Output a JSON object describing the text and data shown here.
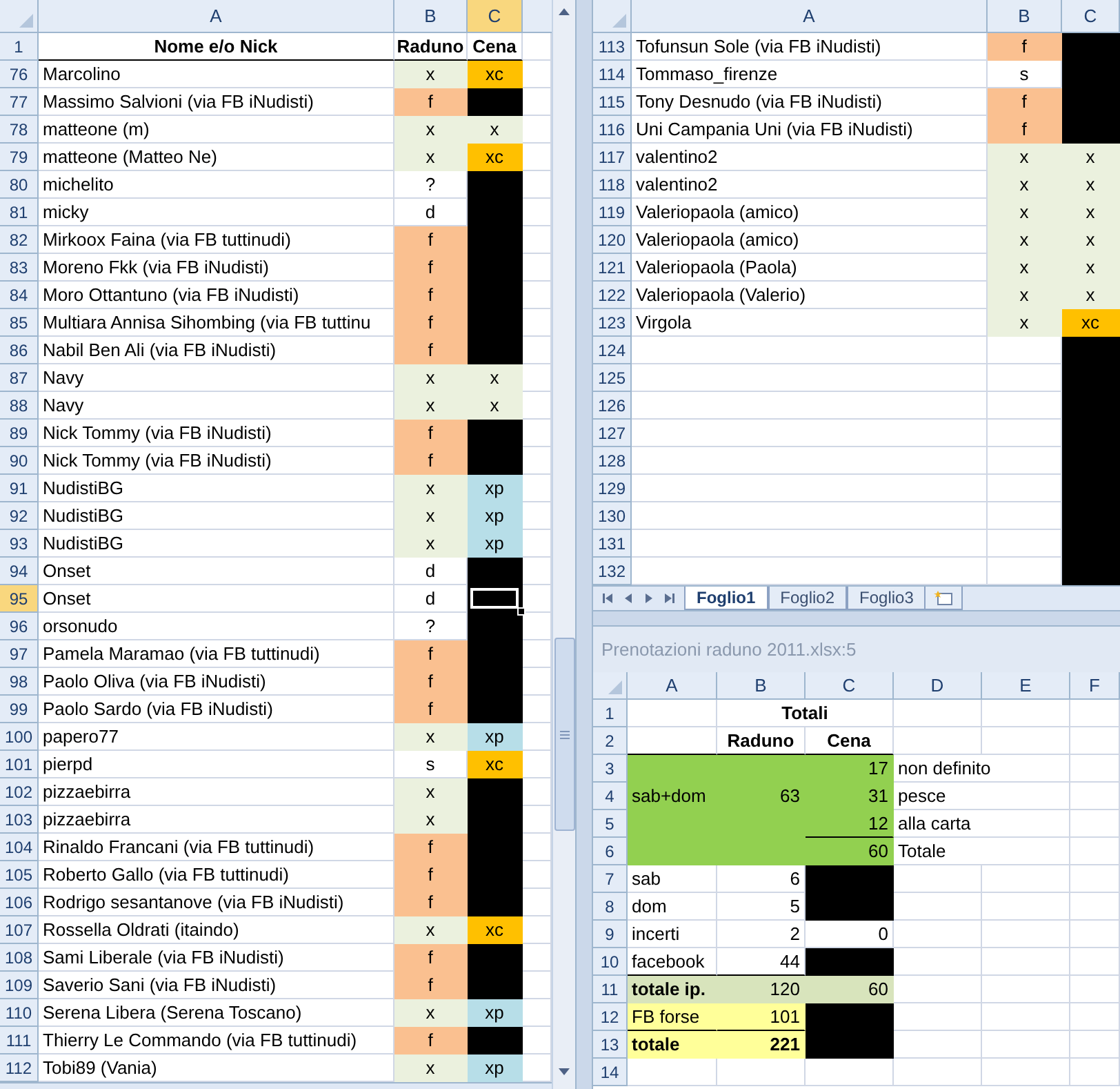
{
  "left_pane": {
    "columns": [
      {
        "label": "A",
        "selected": false
      },
      {
        "label": "B",
        "selected": false
      },
      {
        "label": "C",
        "selected": true
      }
    ],
    "header_row": {
      "number": "1",
      "name": "Nome e/o Nick",
      "raduno": "Raduno",
      "cena": "Cena"
    },
    "rows": [
      {
        "number": "76",
        "selected": false,
        "name": "Marcolino",
        "raduno": {
          "text": "x",
          "color": "#ebf1de"
        },
        "cena": {
          "text": "xc",
          "color": "#ffc000"
        }
      },
      {
        "number": "77",
        "selected": false,
        "name": "Massimo Salvioni (via FB iNudisti)",
        "raduno": {
          "text": "f",
          "color": "#fac090"
        },
        "cena": {
          "color": "#000000"
        }
      },
      {
        "number": "78",
        "selected": false,
        "name": "matteone (m)",
        "raduno": {
          "text": "x",
          "color": "#ebf1de"
        },
        "cena": {
          "text": "x",
          "color": "#ebf1de"
        }
      },
      {
        "number": "79",
        "selected": false,
        "name": "matteone (Matteo Ne)",
        "raduno": {
          "text": "x",
          "color": "#ebf1de"
        },
        "cena": {
          "text": "xc",
          "color": "#ffc000"
        }
      },
      {
        "number": "80",
        "selected": false,
        "name": "michelito",
        "raduno": {
          "text": "?"
        },
        "cena": {
          "color": "#000000"
        }
      },
      {
        "number": "81",
        "selected": false,
        "name": "micky",
        "raduno": {
          "text": "d"
        },
        "cena": {
          "color": "#000000"
        }
      },
      {
        "number": "82",
        "selected": false,
        "name": "Mirkoox Faina (via FB tuttinudi)",
        "raduno": {
          "text": "f",
          "color": "#fac090"
        },
        "cena": {
          "color": "#000000"
        }
      },
      {
        "number": "83",
        "selected": false,
        "name": "Moreno Fkk (via FB iNudisti)",
        "raduno": {
          "text": "f",
          "color": "#fac090"
        },
        "cena": {
          "color": "#000000"
        }
      },
      {
        "number": "84",
        "selected": false,
        "name": "Moro Ottantuno (via FB iNudisti)",
        "raduno": {
          "text": "f",
          "color": "#fac090"
        },
        "cena": {
          "color": "#000000"
        }
      },
      {
        "number": "85",
        "selected": false,
        "name": "Multiara Annisa Sihombing (via FB tuttinu",
        "raduno": {
          "text": "f",
          "color": "#fac090"
        },
        "cena": {
          "color": "#000000"
        }
      },
      {
        "number": "86",
        "selected": false,
        "name": "Nabil Ben Ali (via FB iNudisti)",
        "raduno": {
          "text": "f",
          "color": "#fac090"
        },
        "cena": {
          "color": "#000000"
        }
      },
      {
        "number": "87",
        "selected": false,
        "name": "Navy",
        "raduno": {
          "text": "x",
          "color": "#ebf1de"
        },
        "cena": {
          "text": "x",
          "color": "#ebf1de"
        }
      },
      {
        "number": "88",
        "selected": false,
        "name": "Navy",
        "raduno": {
          "text": "x",
          "color": "#ebf1de"
        },
        "cena": {
          "text": "x",
          "color": "#ebf1de"
        }
      },
      {
        "number": "89",
        "selected": false,
        "name": "Nick Tommy (via FB iNudisti)",
        "raduno": {
          "text": "f",
          "color": "#fac090"
        },
        "cena": {
          "color": "#000000"
        }
      },
      {
        "number": "90",
        "selected": false,
        "name": "Nick Tommy (via FB iNudisti)",
        "raduno": {
          "text": "f",
          "color": "#fac090"
        },
        "cena": {
          "color": "#000000"
        }
      },
      {
        "number": "91",
        "selected": false,
        "name": "NudistiBG",
        "raduno": {
          "text": "x",
          "color": "#ebf1de"
        },
        "cena": {
          "text": "xp",
          "color": "#b7dee8"
        }
      },
      {
        "number": "92",
        "selected": false,
        "name": "NudistiBG",
        "raduno": {
          "text": "x",
          "color": "#ebf1de"
        },
        "cena": {
          "text": "xp",
          "color": "#b7dee8"
        }
      },
      {
        "number": "93",
        "selected": false,
        "name": "NudistiBG",
        "raduno": {
          "text": "x",
          "color": "#ebf1de"
        },
        "cena": {
          "text": "xp",
          "color": "#b7dee8"
        }
      },
      {
        "number": "94",
        "selected": false,
        "name": "Onset",
        "raduno": {
          "text": "d"
        },
        "cena": {
          "color": "#000000"
        }
      },
      {
        "number": "95",
        "selected": true,
        "name": "Onset",
        "raduno": {
          "text": "d"
        },
        "cena": {
          "color": "#000000"
        }
      },
      {
        "number": "96",
        "selected": false,
        "name": "orsonudo",
        "raduno": {
          "text": "?"
        },
        "cena": {
          "color": "#000000"
        }
      },
      {
        "number": "97",
        "selected": false,
        "name": "Pamela Maramao (via FB tuttinudi)",
        "raduno": {
          "text": "f",
          "color": "#fac090"
        },
        "cena": {
          "color": "#000000"
        }
      },
      {
        "number": "98",
        "selected": false,
        "name": "Paolo Oliva (via FB iNudisti)",
        "raduno": {
          "text": "f",
          "color": "#fac090"
        },
        "cena": {
          "color": "#000000"
        }
      },
      {
        "number": "99",
        "selected": false,
        "name": "Paolo Sardo (via FB iNudisti)",
        "raduno": {
          "text": "f",
          "color": "#fac090"
        },
        "cena": {
          "color": "#000000"
        }
      },
      {
        "number": "100",
        "selected": false,
        "name": "papero77",
        "raduno": {
          "text": "x",
          "color": "#ebf1de"
        },
        "cena": {
          "text": "xp",
          "color": "#b7dee8"
        }
      },
      {
        "number": "101",
        "selected": false,
        "name": "pierpd",
        "raduno": {
          "text": "s"
        },
        "cena": {
          "text": "xc",
          "color": "#ffc000"
        }
      },
      {
        "number": "102",
        "selected": false,
        "name": "pizzaebirra",
        "raduno": {
          "text": "x",
          "color": "#ebf1de"
        },
        "cena": {
          "color": "#000000"
        }
      },
      {
        "number": "103",
        "selected": false,
        "name": "pizzaebirra",
        "raduno": {
          "text": "x",
          "color": "#ebf1de"
        },
        "cena": {
          "color": "#000000"
        }
      },
      {
        "number": "104",
        "selected": false,
        "name": "Rinaldo Francani (via FB tuttinudi)",
        "raduno": {
          "text": "f",
          "color": "#fac090"
        },
        "cena": {
          "color": "#000000"
        }
      },
      {
        "number": "105",
        "selected": false,
        "name": "Roberto Gallo (via FB tuttinudi)",
        "raduno": {
          "text": "f",
          "color": "#fac090"
        },
        "cena": {
          "color": "#000000"
        }
      },
      {
        "number": "106",
        "selected": false,
        "name": "Rodrigo sesantanove (via FB iNudisti)",
        "raduno": {
          "text": "f",
          "color": "#fac090"
        },
        "cena": {
          "color": "#000000"
        }
      },
      {
        "number": "107",
        "selected": false,
        "name": "Rossella Oldrati (itaindo)",
        "raduno": {
          "text": "x",
          "color": "#ebf1de"
        },
        "cena": {
          "text": "xc",
          "color": "#ffc000"
        }
      },
      {
        "number": "108",
        "selected": false,
        "name": "Sami Liberale (via FB iNudisti)",
        "raduno": {
          "text": "f",
          "color": "#fac090"
        },
        "cena": {
          "color": "#000000"
        }
      },
      {
        "number": "109",
        "selected": false,
        "name": "Saverio Sani (via FB iNudisti)",
        "raduno": {
          "text": "f",
          "color": "#fac090"
        },
        "cena": {
          "color": "#000000"
        }
      },
      {
        "number": "110",
        "selected": false,
        "name": "Serena Libera (Serena Toscano)",
        "raduno": {
          "text": "x",
          "color": "#ebf1de"
        },
        "cena": {
          "text": "xp",
          "color": "#b7dee8"
        }
      },
      {
        "number": "111",
        "selected": false,
        "name": "Thierry Le Commando (via FB tuttinudi)",
        "raduno": {
          "text": "f",
          "color": "#fac090"
        },
        "cena": {
          "color": "#000000"
        }
      },
      {
        "number": "112",
        "selected": false,
        "name": "Tobi89 (Vania)",
        "raduno": {
          "text": "x",
          "color": "#ebf1de"
        },
        "cena": {
          "text": "xp",
          "color": "#b7dee8"
        }
      }
    ]
  },
  "right_pane": {
    "columns": [
      {
        "label": "A",
        "selected": false
      },
      {
        "label": "B",
        "selected": false
      },
      {
        "label": "C",
        "selected": false
      }
    ],
    "rows": [
      {
        "number": "113",
        "selected": false,
        "name": "Tofunsun Sole (via FB iNudisti)",
        "raduno": {
          "text": "f",
          "color": "#fac090"
        },
        "cena": {
          "color": "#000000"
        }
      },
      {
        "number": "114",
        "selected": false,
        "name": "Tommaso_firenze",
        "raduno": {
          "text": "s"
        },
        "cena": {
          "color": "#000000"
        }
      },
      {
        "number": "115",
        "selected": false,
        "name": "Tony Desnudo (via FB iNudisti)",
        "raduno": {
          "text": "f",
          "color": "#fac090"
        },
        "cena": {
          "color": "#000000"
        }
      },
      {
        "number": "116",
        "selected": false,
        "name": "Uni Campania Uni (via FB iNudisti)",
        "raduno": {
          "text": "f",
          "color": "#fac090"
        },
        "cena": {
          "color": "#000000"
        }
      },
      {
        "number": "117",
        "selected": false,
        "name": "valentino2",
        "raduno": {
          "text": "x",
          "color": "#ebf1de"
        },
        "cena": {
          "text": "x",
          "color": "#ebf1de"
        }
      },
      {
        "number": "118",
        "selected": false,
        "name": "valentino2",
        "raduno": {
          "text": "x",
          "color": "#ebf1de"
        },
        "cena": {
          "text": "x",
          "color": "#ebf1de"
        }
      },
      {
        "number": "119",
        "selected": false,
        "name": "Valeriopaola (amico)",
        "raduno": {
          "text": "x",
          "color": "#ebf1de"
        },
        "cena": {
          "text": "x",
          "color": "#ebf1de"
        }
      },
      {
        "number": "120",
        "selected": false,
        "name": "Valeriopaola (amico)",
        "raduno": {
          "text": "x",
          "color": "#ebf1de"
        },
        "cena": {
          "text": "x",
          "color": "#ebf1de"
        }
      },
      {
        "number": "121",
        "selected": false,
        "name": "Valeriopaola (Paola)",
        "raduno": {
          "text": "x",
          "color": "#ebf1de"
        },
        "cena": {
          "text": "x",
          "color": "#ebf1de"
        }
      },
      {
        "number": "122",
        "selected": false,
        "name": "Valeriopaola (Valerio)",
        "raduno": {
          "text": "x",
          "color": "#ebf1de"
        },
        "cena": {
          "text": "x",
          "color": "#ebf1de"
        }
      },
      {
        "number": "123",
        "selected": false,
        "name": "Virgola",
        "raduno": {
          "text": "x",
          "color": "#ebf1de"
        },
        "cena": {
          "text": "xc",
          "color": "#ffc000"
        }
      },
      {
        "number": "124",
        "selected": false,
        "cena": {
          "color": "#000000"
        }
      },
      {
        "number": "125",
        "selected": false,
        "cena": {
          "color": "#000000"
        }
      },
      {
        "number": "126",
        "selected": false,
        "cena": {
          "color": "#000000"
        }
      },
      {
        "number": "127",
        "selected": false,
        "cena": {
          "color": "#000000"
        }
      },
      {
        "number": "128",
        "selected": false,
        "cena": {
          "color": "#000000"
        }
      },
      {
        "number": "129",
        "selected": false,
        "cena": {
          "color": "#000000"
        }
      },
      {
        "number": "130",
        "selected": false,
        "cena": {
          "color": "#000000"
        }
      },
      {
        "number": "131",
        "selected": false,
        "cena": {
          "color": "#000000"
        }
      },
      {
        "number": "132",
        "selected": false,
        "cena": {
          "color": "#000000"
        }
      }
    ],
    "sheet_tabs": [
      {
        "label": "Foglio1",
        "selected": true
      },
      {
        "label": "Foglio2",
        "selected": false
      },
      {
        "label": "Foglio3",
        "selected": false
      }
    ]
  },
  "bottom_pane": {
    "title": "Prenotazioni raduno 2011.xlsx:5",
    "columns": [
      "A",
      "B",
      "C",
      "D",
      "E",
      "F"
    ],
    "rows": [
      {
        "number": "1",
        "cells": [
          {},
          {
            "text": "Totali",
            "kind": "wide_heading",
            "bold": true
          }
        ]
      },
      {
        "number": "2",
        "cells": [
          {
            "rule_below": true
          },
          {
            "text": "Raduno",
            "kind": "heading",
            "bold": true,
            "rule_below": true
          },
          {
            "text": "Cena",
            "kind": "heading",
            "bold": true,
            "rule_below": true
          }
        ]
      },
      {
        "number": "3",
        "cells": [
          {
            "color": "#92d050"
          },
          {
            "color": "#92d050"
          },
          {
            "text": "17",
            "kind": "number",
            "color": "#92d050"
          },
          {
            "text": "non definito",
            "kind": "label"
          }
        ]
      },
      {
        "number": "4",
        "cells": [
          {
            "text": "sab+dom",
            "kind": "label",
            "color": "#92d050"
          },
          {
            "text": "63",
            "kind": "number",
            "color": "#92d050"
          },
          {
            "text": "31",
            "kind": "number",
            "color": "#92d050"
          },
          {
            "text": "pesce",
            "kind": "label"
          }
        ]
      },
      {
        "number": "5",
        "cells": [
          {
            "color": "#92d050"
          },
          {
            "color": "#92d050"
          },
          {
            "text": "12",
            "kind": "number",
            "color": "#92d050",
            "rule_below": true
          },
          {
            "text": "alla carta",
            "kind": "label"
          }
        ]
      },
      {
        "number": "6",
        "cells": [
          {
            "color": "#92d050"
          },
          {
            "color": "#92d050"
          },
          {
            "text": "60",
            "kind": "number",
            "color": "#92d050"
          },
          {
            "text": "Totale",
            "kind": "label"
          }
        ]
      },
      {
        "number": "7",
        "cells": [
          {
            "text": "sab",
            "kind": "label"
          },
          {
            "text": "6",
            "kind": "number"
          },
          {
            "color": "#000000"
          }
        ]
      },
      {
        "number": "8",
        "cells": [
          {
            "text": "dom",
            "kind": "label"
          },
          {
            "text": "5",
            "kind": "number"
          },
          {
            "color": "#000000"
          }
        ]
      },
      {
        "number": "9",
        "cells": [
          {
            "text": "incerti",
            "kind": "label"
          },
          {
            "text": "2",
            "kind": "number"
          },
          {
            "text": "0",
            "kind": "number"
          }
        ]
      },
      {
        "number": "10",
        "cells": [
          {
            "text": "facebook",
            "kind": "label",
            "rule_below": true
          },
          {
            "text": "44",
            "kind": "number",
            "rule_below": true
          },
          {
            "color": "#000000"
          }
        ]
      },
      {
        "number": "11",
        "cells": [
          {
            "text": "totale ip.",
            "kind": "label",
            "bold": true,
            "color": "#d8e4bc"
          },
          {
            "text": "120",
            "kind": "number",
            "color": "#d8e4bc"
          },
          {
            "text": "60",
            "kind": "number",
            "color": "#d8e4bc"
          }
        ]
      },
      {
        "number": "12",
        "cells": [
          {
            "text": "FB forse",
            "kind": "label",
            "color": "#ffff99",
            "rule_below": true
          },
          {
            "text": "101",
            "kind": "number",
            "color": "#ffff99",
            "rule_below": true
          },
          {
            "color": "#000000"
          }
        ]
      },
      {
        "number": "13",
        "cells": [
          {
            "text": "totale",
            "kind": "label",
            "bold": true,
            "color": "#ffff99"
          },
          {
            "text": "221",
            "kind": "number",
            "bold": true,
            "color": "#ffff99"
          },
          {
            "color": "#000000"
          }
        ]
      },
      {
        "number": "14",
        "cells": []
      }
    ]
  }
}
